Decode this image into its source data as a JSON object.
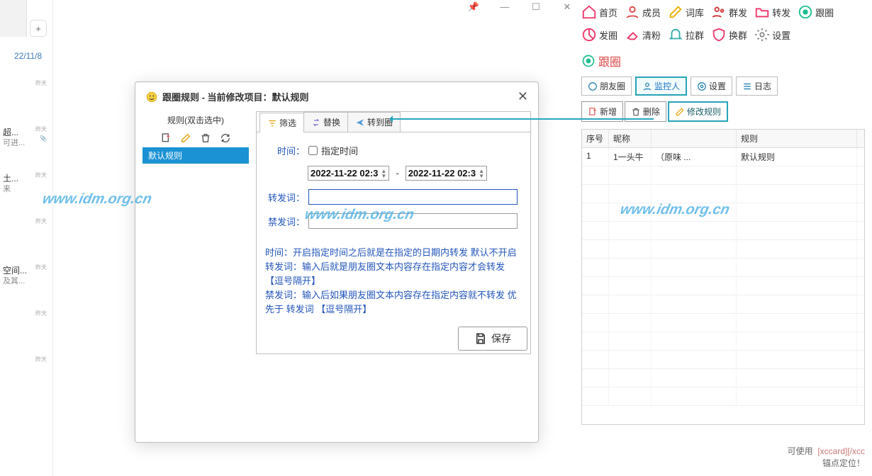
{
  "left": {
    "date": "22/11/8",
    "items": [
      {
        "tag": "昨天"
      },
      {
        "tag": "昨天",
        "t1": "超...",
        "t2": "可进..."
      },
      {
        "tag": "昨天",
        "t1": "土...",
        "t2": "来"
      },
      {
        "tag": "昨天"
      },
      {
        "tag": "昨天",
        "t1": "空间...",
        "t2": "及其..."
      },
      {
        "tag": "昨天"
      },
      {
        "tag": "昨天"
      }
    ],
    "plus": "+"
  },
  "win": {
    "pin": "📌",
    "min": "—",
    "max": "☐",
    "close": "✕"
  },
  "toolbar": [
    {
      "name": "home",
      "label": "首页",
      "color": "#e36"
    },
    {
      "name": "members",
      "label": "成员",
      "color": "#d44"
    },
    {
      "name": "dict",
      "label": "词库",
      "color": "#e8b000"
    },
    {
      "name": "bulk",
      "label": "群发",
      "color": "#c33"
    },
    {
      "name": "forward",
      "label": "转发",
      "color": "#e36"
    },
    {
      "name": "follow",
      "label": "跟圈",
      "color": "#1abe8f"
    },
    {
      "name": "post",
      "label": "发圈",
      "color": "#e36"
    },
    {
      "name": "clean",
      "label": "清粉",
      "color": "#e36"
    },
    {
      "name": "pull",
      "label": "拉群",
      "color": "#3a8"
    },
    {
      "name": "swap",
      "label": "换群",
      "color": "#e36"
    },
    {
      "name": "settings",
      "label": "设置",
      "color": "#888"
    }
  ],
  "section_title": "跟圈",
  "sub_tabs": [
    {
      "name": "moments",
      "label": "朋友圈"
    },
    {
      "name": "monitor",
      "label": "监控人",
      "active": true
    },
    {
      "name": "settings",
      "label": "设置"
    },
    {
      "name": "log",
      "label": "日志"
    }
  ],
  "actions": [
    {
      "name": "new",
      "label": "新增"
    },
    {
      "name": "delete",
      "label": "删除"
    },
    {
      "name": "edit-rule",
      "label": "修改规则",
      "hl": true
    }
  ],
  "table": {
    "headers": {
      "seq": "序号",
      "nick": "昵称",
      "desc": "",
      "rule": "规则"
    },
    "rows": [
      {
        "seq": "1",
        "nick": "1一头牛",
        "desc": "（原味 ...",
        "rule": "默认规则"
      }
    ]
  },
  "footer": {
    "pre": "可使用",
    "code": "[xccard][/xcc",
    "t2": "锚点定位！"
  },
  "dialog": {
    "title": "跟圈规则 - 当前修改项目：默认规则",
    "rules_label": "规则(双击选中)",
    "rule_item": "默认规则",
    "tabs": [
      {
        "name": "filter",
        "label": "筛选",
        "active": true
      },
      {
        "name": "replace",
        "label": "替换"
      },
      {
        "name": "forward-to",
        "label": "转到圈"
      }
    ],
    "form": {
      "time_label": "时间：",
      "time_cb": "指定时间",
      "date1": "2022-11-22 02:3",
      "date_sep": "-",
      "date2": "2022-11-22 02:3",
      "fw_label": "转发词：",
      "ban_label": "禁发词："
    },
    "help": "时间：开启指定时间之后就是在指定的日期内转发 默认不开启\n转发词：输入后就是朋友圈文本内容存在指定内容才会转发【逗号隔开】\n禁发词：输入后如果朋友圈文本内容存在指定内容就不转发 优先于 转发词 【逗号隔开】",
    "save": "保存"
  },
  "watermark": "www.idm.org.cn"
}
